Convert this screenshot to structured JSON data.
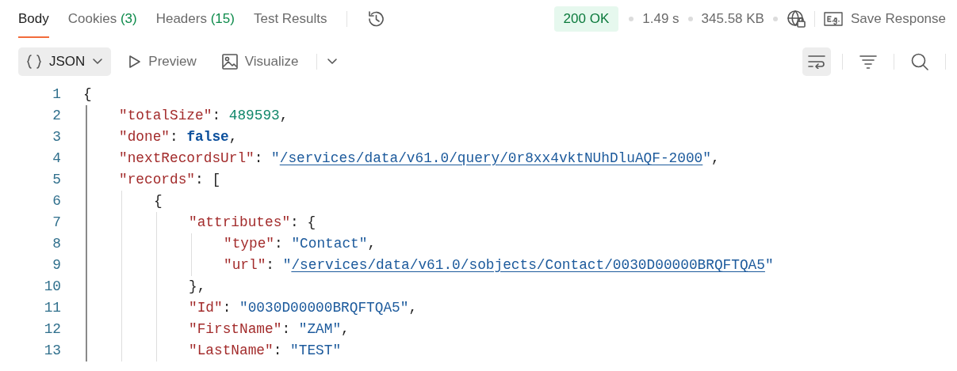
{
  "tabs": [
    {
      "label": "Body",
      "selected": true
    },
    {
      "label": "Cookies",
      "count": "(3)",
      "selected": false
    },
    {
      "label": "Headers",
      "count": "(15)",
      "selected": false
    },
    {
      "label": "Test Results",
      "selected": false
    }
  ],
  "status": {
    "code": "200 OK",
    "time": "1.49 s",
    "size": "345.58 KB"
  },
  "save_response": {
    "label": "Save Response"
  },
  "view_modes": [
    {
      "label": "JSON",
      "kind": "braces",
      "dropdown": true,
      "selected": true
    },
    {
      "label": "Preview",
      "kind": "play",
      "selected": false
    },
    {
      "label": "Visualize",
      "kind": "image",
      "selected": false
    }
  ],
  "tools": [
    {
      "kind": "wrap",
      "on": true
    },
    {
      "kind": "filter",
      "on": false
    },
    {
      "kind": "search",
      "on": false
    }
  ],
  "code": [
    {
      "number": "1",
      "tokens": [
        {
          "kind": "punct",
          "text": "{"
        }
      ],
      "children": [
        {
          "number": "2",
          "tokens": [
            {
              "kind": "key",
              "text": "\"totalSize\""
            },
            {
              "kind": "punct",
              "text": ": "
            },
            {
              "kind": "number",
              "text": "489593"
            },
            {
              "kind": "punct",
              "text": ","
            }
          ]
        },
        {
          "number": "3",
          "tokens": [
            {
              "kind": "key",
              "text": "\"done\""
            },
            {
              "kind": "punct",
              "text": ": "
            },
            {
              "kind": "bool",
              "text": "false"
            },
            {
              "kind": "punct",
              "text": ","
            }
          ]
        },
        {
          "number": "4",
          "tokens": [
            {
              "kind": "key",
              "text": "\"nextRecordsUrl\""
            },
            {
              "kind": "punct",
              "text": ": "
            },
            {
              "kind": "string",
              "text": "\""
            },
            {
              "kind": "link",
              "text": "/services/data/v61.0/query/0r8xx4vktNUhDluAQF-2000"
            },
            {
              "kind": "string",
              "text": "\""
            },
            {
              "kind": "punct",
              "text": ","
            }
          ]
        },
        {
          "number": "5",
          "tokens": [
            {
              "kind": "key",
              "text": "\"records\""
            },
            {
              "kind": "punct",
              "text": ": ["
            }
          ],
          "children": [
            {
              "number": "6",
              "tokens": [
                {
                  "kind": "punct",
                  "text": "{"
                }
              ],
              "children": [
                {
                  "number": "7",
                  "tokens": [
                    {
                      "kind": "key",
                      "text": "\"attributes\""
                    },
                    {
                      "kind": "punct",
                      "text": ": {"
                    }
                  ],
                  "children": [
                    {
                      "number": "8",
                      "tokens": [
                        {
                          "kind": "key",
                          "text": "\"type\""
                        },
                        {
                          "kind": "punct",
                          "text": ": "
                        },
                        {
                          "kind": "string",
                          "text": "\"Contact\""
                        },
                        {
                          "kind": "punct",
                          "text": ","
                        }
                      ]
                    },
                    {
                      "number": "9",
                      "tokens": [
                        {
                          "kind": "key",
                          "text": "\"url\""
                        },
                        {
                          "kind": "punct",
                          "text": ": "
                        },
                        {
                          "kind": "string",
                          "text": "\""
                        },
                        {
                          "kind": "link",
                          "text": "/services/data/v61.0/sobjects/Contact/0030D00000BRQFTQA5"
                        },
                        {
                          "kind": "string",
                          "text": "\""
                        }
                      ]
                    }
                  ]
                },
                {
                  "number": "10",
                  "tokens": [
                    {
                      "kind": "punct",
                      "text": "},"
                    }
                  ]
                },
                {
                  "number": "11",
                  "tokens": [
                    {
                      "kind": "key",
                      "text": "\"Id\""
                    },
                    {
                      "kind": "punct",
                      "text": ": "
                    },
                    {
                      "kind": "string",
                      "text": "\"0030D00000BRQFTQA5\""
                    },
                    {
                      "kind": "punct",
                      "text": ","
                    }
                  ]
                },
                {
                  "number": "12",
                  "tokens": [
                    {
                      "kind": "key",
                      "text": "\"FirstName\""
                    },
                    {
                      "kind": "punct",
                      "text": ": "
                    },
                    {
                      "kind": "string",
                      "text": "\"ZAM\""
                    },
                    {
                      "kind": "punct",
                      "text": ","
                    }
                  ]
                },
                {
                  "number": "13",
                  "tokens": [
                    {
                      "kind": "key",
                      "text": "\"LastName\""
                    },
                    {
                      "kind": "punct",
                      "text": ": "
                    },
                    {
                      "kind": "string",
                      "text": "\"TEST\""
                    }
                  ]
                }
              ]
            }
          ]
        }
      ]
    }
  ]
}
